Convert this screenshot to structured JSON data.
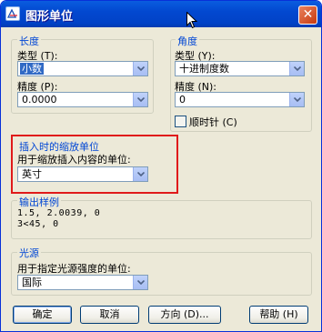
{
  "window": {
    "title": "图形单位",
    "close_glyph": "✕"
  },
  "length": {
    "group_label": "长度",
    "type_label": "类型 (T):",
    "type_value": "小数",
    "precision_label": "精度 (P):",
    "precision_value": "0.0000"
  },
  "angle": {
    "group_label": "角度",
    "type_label": "类型 (Y):",
    "type_value": "十进制度数",
    "precision_label": "精度 (N):",
    "precision_value": "0",
    "clockwise_label": "顺时针 (C)",
    "clockwise_checked": false
  },
  "insertion": {
    "group_label": "插入时的缩放单位",
    "desc_label": "用于缩放插入内容的单位:",
    "value": "英寸"
  },
  "sample": {
    "group_label": "输出样例",
    "line1": "1.5, 2.0039, 0",
    "line2": "3<45, 0"
  },
  "lighting": {
    "group_label": "光源",
    "desc_label": "用于指定光源强度的单位:",
    "value": "国际"
  },
  "buttons": {
    "ok": "确定",
    "cancel": "取消",
    "direction": "方向 (D)...",
    "help": "帮助 (H)"
  },
  "colors": {
    "highlight_frame": "#e01a1a",
    "group_label": "#0046d5",
    "selection": "#316ac5"
  }
}
